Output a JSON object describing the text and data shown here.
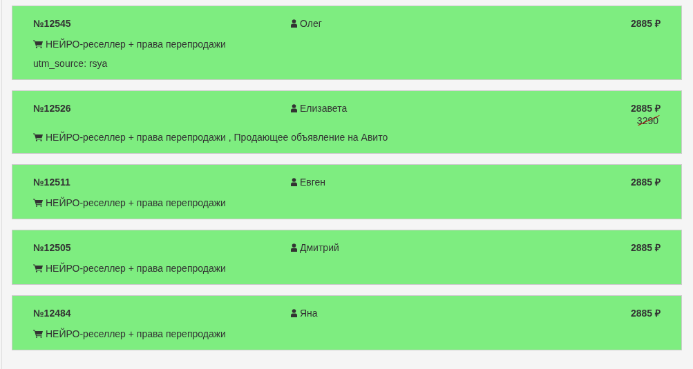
{
  "orders": [
    {
      "number": "№12545",
      "customer": "Олег",
      "price": "2885 ₽",
      "products": "НЕЙРО-реселлер + права перепродажи",
      "utm": "utm_source: rsya"
    },
    {
      "number": "№12526",
      "customer": "Елизавета",
      "price": "2885 ₽",
      "old_price": "3290",
      "products": "НЕЙРО-реселлер + права перепродажи , Продающее объявление на Авито"
    },
    {
      "number": "№12511",
      "customer": "Евген",
      "price": "2885 ₽",
      "products": "НЕЙРО-реселлер + права перепродажи"
    },
    {
      "number": "№12505",
      "customer": "Дмитрий",
      "price": "2885 ₽",
      "products": "НЕЙРО-реселлер + права перепродажи"
    },
    {
      "number": "№12484",
      "customer": "Яна",
      "price": "2885 ₽",
      "products": "НЕЙРО-реселлер + права перепродажи"
    }
  ]
}
